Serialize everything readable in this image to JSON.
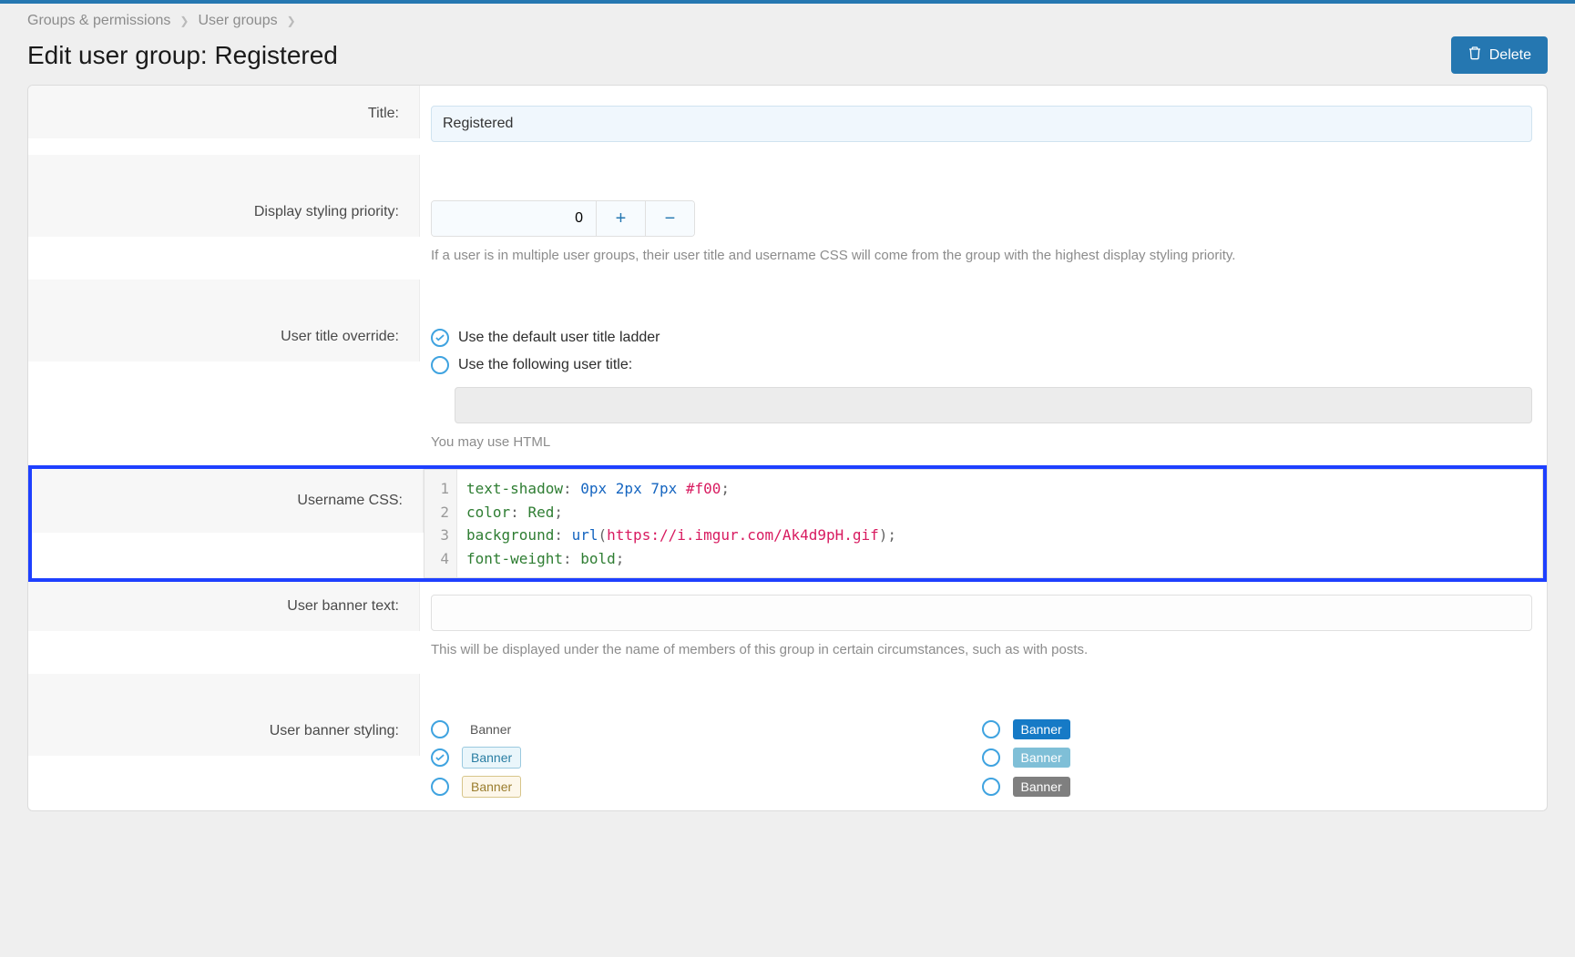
{
  "breadcrumb": {
    "item1": "Groups & permissions",
    "item2": "User groups"
  },
  "header": {
    "title": "Edit user group: Registered",
    "delete_label": "Delete"
  },
  "form": {
    "title_label": "Title:",
    "title_value": "Registered",
    "priority_label": "Display styling priority:",
    "priority_value": "0",
    "priority_explain": "If a user is in multiple user groups, their user title and username CSS will come from the group with the highest display styling priority.",
    "title_override_label": "User title override:",
    "title_override_opt1": "Use the default user title ladder",
    "title_override_opt2": "Use the following user title:",
    "title_override_hint": "You may use HTML",
    "username_css_label": "Username CSS:",
    "css": {
      "l1_prop": "text-shadow",
      "l1_v1": "0px",
      "l1_v2": "2px",
      "l1_v3": "7px",
      "l1_v4": "#f00",
      "l2_prop": "color",
      "l2_v": "Red",
      "l3_prop": "background",
      "l3_fn": "url",
      "l3_url": "https://i.imgur.com/Ak4d9pH.gif",
      "l4_prop": "font-weight",
      "l4_v": "bold",
      "ln1": "1",
      "ln2": "2",
      "ln3": "3",
      "ln4": "4"
    },
    "banner_text_label": "User banner text:",
    "banner_text_explain": "This will be displayed under the name of members of this group in certain circumstances, such as with posts.",
    "banner_styling_label": "User banner styling:",
    "banner_word": "Banner"
  }
}
